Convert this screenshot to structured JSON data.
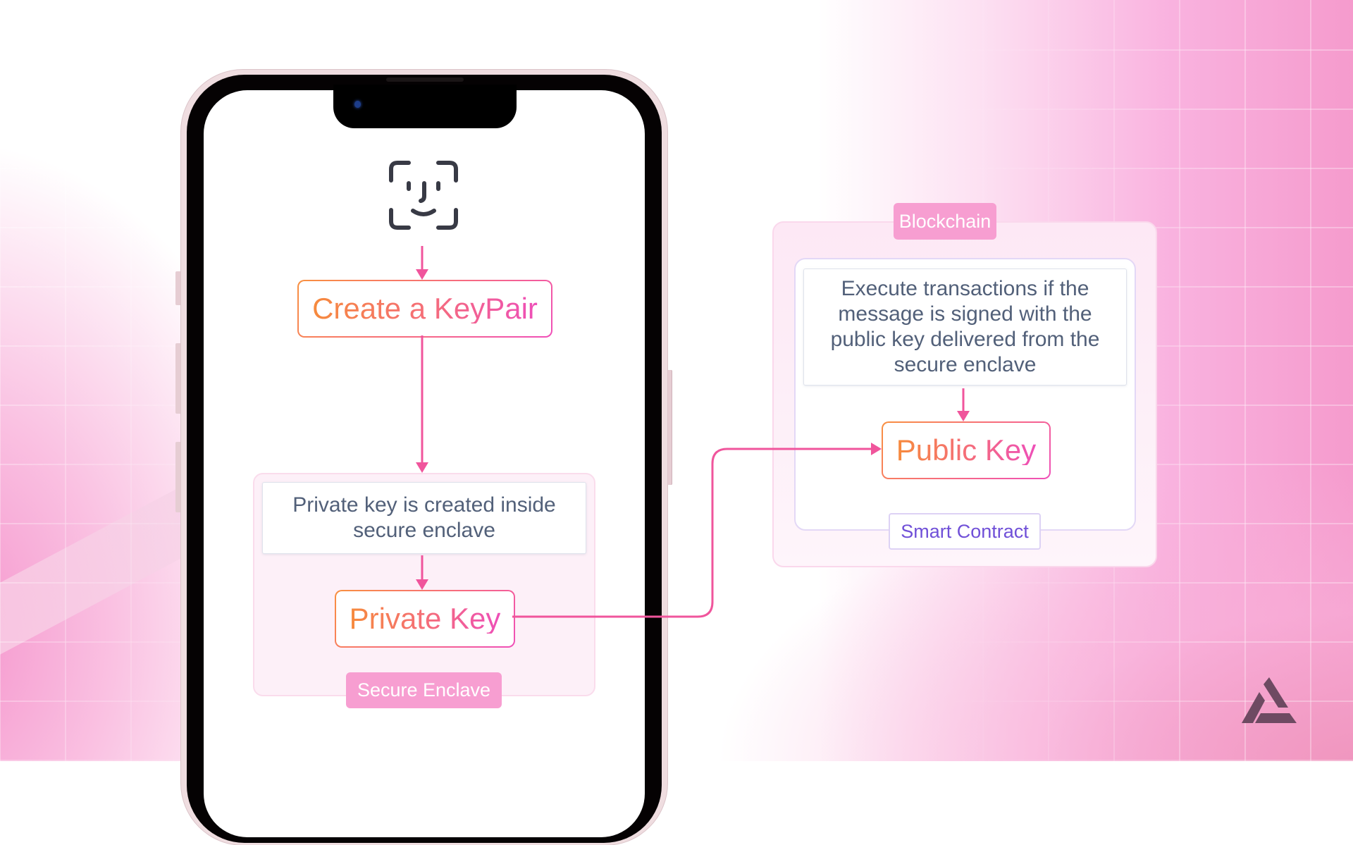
{
  "colors": {
    "accent_pink": "#f04f98",
    "label_pink": "#f79ed1",
    "text_slate": "#526079",
    "contract_purple": "#7050d8",
    "logo": "#6e4a62"
  },
  "icons": {
    "face_id": "face-id-icon",
    "logo": "triangle-logo-icon"
  },
  "phone": {
    "step_create": "Create a KeyPair",
    "enclave": {
      "description": "Private key is created inside secure enclave",
      "key_label": "Private Key",
      "container_label": "Secure Enclave"
    }
  },
  "blockchain": {
    "container_label": "Blockchain",
    "smart_contract": {
      "description": "Execute transactions if the message is signed with the public key delivered from the secure enclave",
      "key_label": "Public Key",
      "container_label": "Smart Contract"
    }
  },
  "flow": [
    {
      "from": "Face ID",
      "to": "Create a KeyPair"
    },
    {
      "from": "Create a KeyPair",
      "to": "Secure Enclave"
    },
    {
      "from": "Private key is created inside secure enclave",
      "to": "Private Key"
    },
    {
      "from": "Private Key",
      "to": "Public Key"
    },
    {
      "from": "Execute transactions if the message is signed with the public key delivered from the secure enclave",
      "to": "Public Key"
    }
  ]
}
